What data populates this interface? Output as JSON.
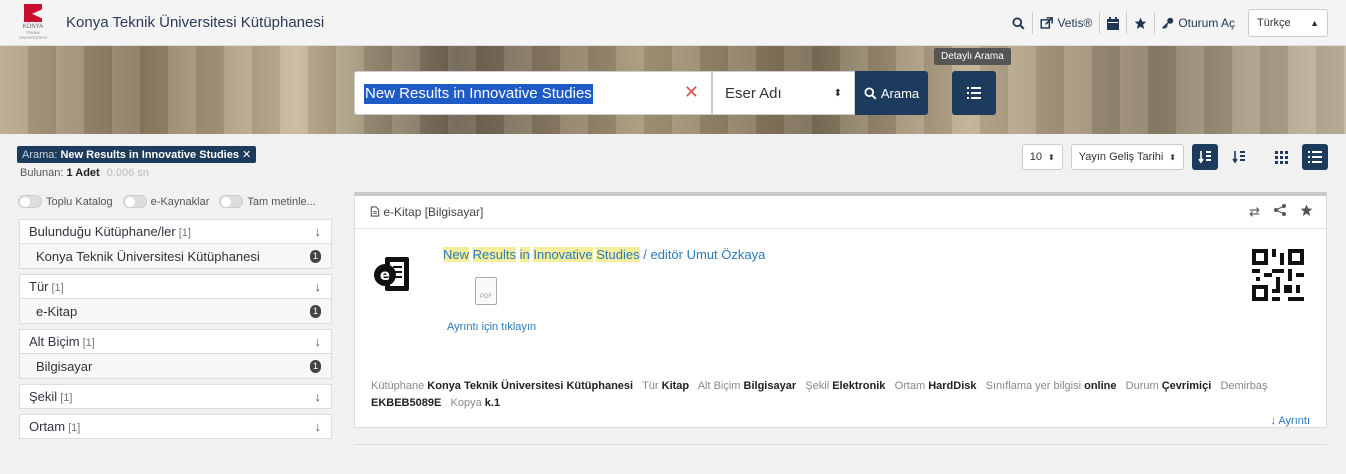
{
  "header": {
    "logo_line1": "KONYA",
    "logo_line2": "TEKNİK ÜNİVERSİTESİ",
    "site_title": "Konya Teknik Üniversitesi Kütüphanesi",
    "vetis_label": "Vetis®",
    "login_label": "Oturum Aç",
    "language": "Türkçe"
  },
  "search": {
    "query": "New Results in Innovative Studies",
    "field": "Eser Adı",
    "search_button": "Arama",
    "advanced_tooltip": "Detaylı Arama"
  },
  "results": {
    "query_label": "Arama:",
    "query_value": "New Results in Innovative Studies",
    "found_label": "Bulunan:",
    "found_count": "1 Adet",
    "time": "0.006 sn"
  },
  "toggles": [
    "Toplu Katalog",
    "e-Kaynaklar",
    "Tam metinle..."
  ],
  "facets": [
    {
      "title": "Bulunduğu Kütüphane/ler",
      "count": "[1]",
      "item": "Konya Teknik Üniversitesi Kütüphanesi",
      "item_count": "1"
    },
    {
      "title": "Tür",
      "count": "[1]",
      "item": "e-Kitap",
      "item_count": "1"
    },
    {
      "title": "Alt Biçim",
      "count": "[1]",
      "item": "Bilgisayar",
      "item_count": "1"
    },
    {
      "title": "Şekil",
      "count": "[1]"
    },
    {
      "title": "Ortam",
      "count": "[1]"
    }
  ],
  "controls": {
    "page_size": "10",
    "sort_field": "Yayın Geliş Tarihi"
  },
  "record": {
    "type_label": "e-Kitap [Bilgisayar]",
    "title_words": [
      "New",
      "Results",
      "in",
      "Innovative",
      "Studies"
    ],
    "responsibility": " / editör Umut Özkaya",
    "pdf_label": "PDF",
    "detail_link": "Ayrıntı için tıklayın",
    "meta": [
      {
        "label": "Kütüphane",
        "value": "Konya Teknik Üniversitesi Kütüphanesi"
      },
      {
        "label": "Tür",
        "value": "Kitap"
      },
      {
        "label": "Alt Biçim",
        "value": "Bilgisayar"
      },
      {
        "label": "Şekil",
        "value": "Elektronik"
      },
      {
        "label": "Ortam",
        "value": "HardDisk"
      },
      {
        "label": "Sınıflama yer bilgisi",
        "value": "online"
      },
      {
        "label": "Durum",
        "value": "Çevrimiçi"
      },
      {
        "label": "Demirbaş",
        "value": "EKBEB5089E"
      },
      {
        "label": "Kopya",
        "value": "k.1"
      }
    ],
    "more_label": "Ayrıntı"
  },
  "colors": {
    "navy": "#1d3b5c",
    "link": "#2a7ab8",
    "highlight": "#f5ef9d",
    "logo_red": "#c8102e"
  }
}
